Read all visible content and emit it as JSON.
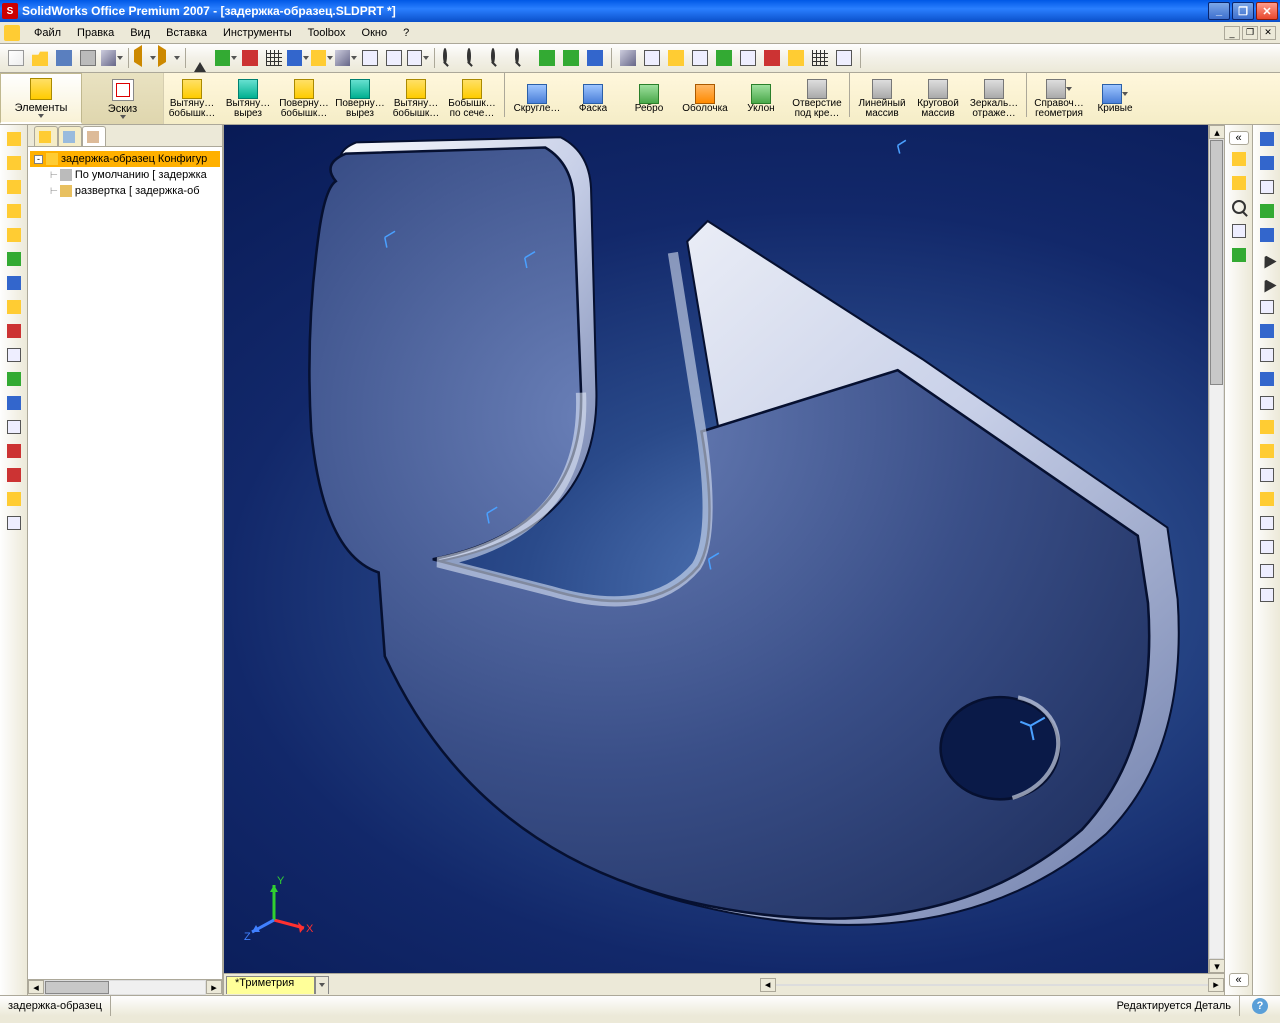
{
  "titlebar": {
    "title": "SolidWorks Office Premium 2007 - [задержка-образец.SLDPRT *]"
  },
  "menubar": {
    "items": [
      "Файл",
      "Правка",
      "Вид",
      "Вставка",
      "Инструменты",
      "Toolbox",
      "Окно",
      "?"
    ]
  },
  "std_toolbar": {
    "groups": [
      [
        "new",
        "open",
        "save",
        "print",
        "cube-dd"
      ],
      [
        "undo-dd",
        "redo-dd"
      ],
      [
        "pointer",
        "rebuild-dd",
        "rebuild2",
        "options",
        "color-dd",
        "material-dd",
        "shaded-dd",
        "hlr",
        "hlv",
        "section"
      ],
      [
        "measure",
        "zoom-fit",
        "zoom-area",
        "zoom-dyn",
        "rotate",
        "pan",
        "prev-view"
      ],
      [
        "iso",
        "front",
        "planes",
        "axis",
        "sketch-rel",
        "curvature",
        "origins",
        "lights",
        "grid"
      ],
      []
    ]
  },
  "cmdmgr": {
    "tabs": [
      {
        "label": "Элементы",
        "active": true
      },
      {
        "label": "Эскиз",
        "active": false
      }
    ],
    "cmds": [
      {
        "l1": "Вытяну…",
        "l2": "бобышк…",
        "ic": "ci-yellow"
      },
      {
        "l1": "Вытяну…",
        "l2": "вырез",
        "ic": "ci-teal"
      },
      {
        "l1": "Поверну…",
        "l2": "бобышк…",
        "ic": "ci-yellow"
      },
      {
        "l1": "Поверну…",
        "l2": "вырез",
        "ic": "ci-teal"
      },
      {
        "l1": "Вытяну…",
        "l2": "бобышк…",
        "ic": "ci-yellow"
      },
      {
        "l1": "Бобышк…",
        "l2": "по сече…",
        "ic": "ci-yellow"
      },
      {
        "sep": true
      },
      {
        "l1": "Скругле…",
        "l2": "",
        "ic": "ci-blue"
      },
      {
        "l1": "Фаска",
        "l2": "",
        "ic": "ci-blue"
      },
      {
        "l1": "Ребро",
        "l2": "",
        "ic": "ci-green"
      },
      {
        "l1": "Оболочка",
        "l2": "",
        "ic": "ci-orange"
      },
      {
        "l1": "Уклон",
        "l2": "",
        "ic": "ci-green"
      },
      {
        "l1": "Отверстие",
        "l2": "под кре…",
        "ic": "ci-gray"
      },
      {
        "sep": true
      },
      {
        "l1": "Линейный",
        "l2": "массив",
        "ic": "ci-gray"
      },
      {
        "l1": "Круговой",
        "l2": "массив",
        "ic": "ci-gray"
      },
      {
        "l1": "Зеркаль…",
        "l2": "отраже…",
        "ic": "ci-gray"
      },
      {
        "sep": true
      },
      {
        "l1": "Справоч…",
        "l2": "геометрия",
        "ic": "ci-gray",
        "dd": true
      },
      {
        "l1": "Кривые",
        "l2": "",
        "ic": "ci-blue",
        "dd": true
      }
    ]
  },
  "left_vtool_icons": [
    "ic-yellow",
    "ic-yellow",
    "ic-yellow",
    "ic-yellow",
    "ic-yellow",
    "ic-green",
    "ic-blue",
    "ic-yellow",
    "ic-red",
    "ic-box",
    "ic-green",
    "ic-blue",
    "ic-box",
    "ic-red",
    "ic-red",
    "ic-yellow",
    "ic-box"
  ],
  "tree": {
    "root": "задержка-образец Конфигур",
    "items": [
      "По умолчанию [ задержка",
      "развертка [ задержка-об"
    ]
  },
  "right_panel1_icons": [
    "ic-yellow",
    "ic-yellow",
    "ic-zoom",
    "ic-box",
    "ic-green"
  ],
  "right_panel2_icons": [
    "ic-blue",
    "ic-blue",
    "ic-box",
    "ic-green",
    "ic-blue",
    "ic-arrow",
    "ic-arrow",
    "ic-box",
    "ic-blue",
    "ic-box",
    "ic-blue",
    "ic-box",
    "ic-yellow",
    "ic-yellow",
    "ic-box",
    "ic-yellow",
    "ic-box",
    "ic-box",
    "ic-box",
    "ic-box"
  ],
  "view_tab": "*Триметрия",
  "statusbar": {
    "left": "задержка-образец",
    "right": "Редактируется Деталь"
  }
}
